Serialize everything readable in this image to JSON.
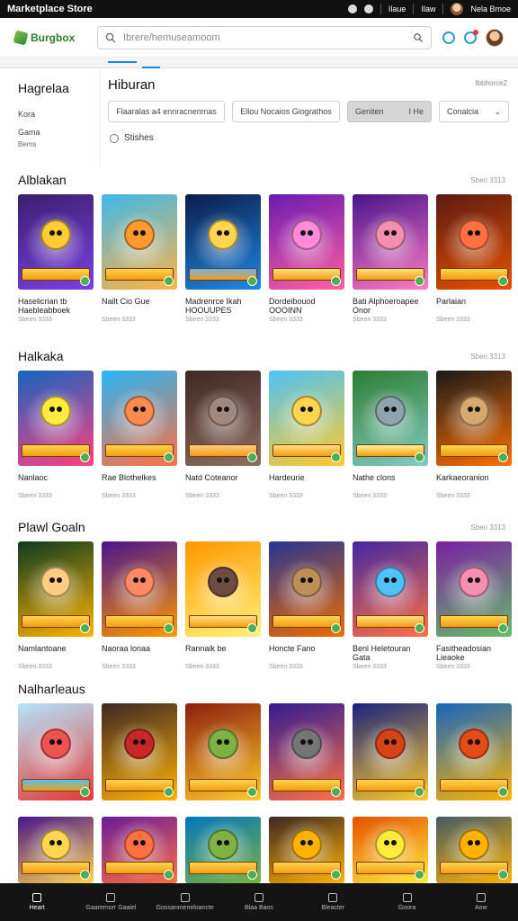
{
  "statusbar": {
    "title": "Marketplace Store",
    "item1": "Ilaue",
    "item2": "Ilaw",
    "user": "Nela Bmoe"
  },
  "header": {
    "logo": "Burgbox",
    "search_placeholder": "Ibrere/hemuseamoom"
  },
  "sidebar": {
    "title": "Hagrelaa",
    "items": [
      "Kora",
      "Gama"
    ],
    "sub": "Bems"
  },
  "main": {
    "title": "Hiburan",
    "topright": "Ibbhorce2",
    "filters": [
      "Flaaralas a4 ennracnenmas",
      "Ellou Nocaios Giograthos",
      "Geniten",
      "Conalcia"
    ],
    "filter_gray_extra": "I He",
    "checkbox_label": "Stishes"
  },
  "sections": [
    {
      "title": "Alblakan",
      "more": "Sberi 3313",
      "cards": [
        {
          "name": "Haselicrian tb Haebleabboek",
          "meta": "Sbeen 3333",
          "bg": "#3a1f6e",
          "accent": "#7b3fe4",
          "char": "#ffcc33",
          "title": "#ffd54f"
        },
        {
          "name": "Nailt Cio Gue",
          "meta": "Sbeen 3333",
          "bg": "#3fb8e8",
          "accent": "#ffb347",
          "char": "#ff9a2e",
          "title": "#ffd54f"
        },
        {
          "name": "Madrenrce Ikah HOOUUPES",
          "meta": "Sbeen 3333",
          "bg": "#0c1d4a",
          "accent": "#1e88e5",
          "char": "#ffd54f",
          "title": "#64b5f6"
        },
        {
          "name": "Dordeibouod OOOINN",
          "meta": "Sbeen 3333",
          "bg": "#6a1bb0",
          "accent": "#ff5fa2",
          "char": "#ff8ad6",
          "title": "#ffe082"
        },
        {
          "name": "Bati Alphoeroapee Onor",
          "meta": "Sbeen 3333",
          "bg": "#4a148c",
          "accent": "#ff7ac3",
          "char": "#f48fb1",
          "title": "#ffe082"
        },
        {
          "name": "Parlaian",
          "meta": "Sbeen 3333",
          "bg": "#5d1a12",
          "accent": "#e65100",
          "char": "#ff7043",
          "title": "#ffd54f"
        }
      ]
    },
    {
      "title": "Halkaka",
      "more": "Sberi 3313",
      "cards": [
        {
          "name": "Nanlaoc",
          "meta": "Sbeen 3333",
          "bg": "#1565c0",
          "accent": "#ff4081",
          "char": "#ffeb3b",
          "title": "#ffd54f"
        },
        {
          "name": "Rae Blothelkes",
          "meta": "Sbeen 3333",
          "bg": "#29b6f6",
          "accent": "#ff7043",
          "char": "#ff8a50",
          "title": "#ffd54f"
        },
        {
          "name": "Natd Coteanor",
          "meta": "Sbeen 3333",
          "bg": "#3e2723",
          "accent": "#8d6e63",
          "char": "#a1887f",
          "title": "#ffcc80"
        },
        {
          "name": "Hardeurie",
          "meta": "Sbeen 3333",
          "bg": "#4fc3f7",
          "accent": "#ffca28",
          "char": "#ffd54f",
          "title": "#ffe082"
        },
        {
          "name": "Nathe clons",
          "meta": "Sbeen 3333",
          "bg": "#2e7d32",
          "accent": "#80cbc4",
          "char": "#90a4ae",
          "title": "#fff59d"
        },
        {
          "name": "Karkaeoranion",
          "meta": "Sbeen 3333",
          "bg": "#1a1a1a",
          "accent": "#ff6f00",
          "char": "#d7a86e",
          "title": "#ffd54f"
        }
      ]
    },
    {
      "title": "Plawl Goaln",
      "more": "Sberi 3313",
      "cards": [
        {
          "name": "Namlantoane",
          "meta": "Sbeen 3333",
          "bg": "#0d3b20",
          "accent": "#ffb300",
          "char": "#ffcc80",
          "title": "#ffd54f"
        },
        {
          "name": "Naoraa lonaa",
          "meta": "Sbeen 3333",
          "bg": "#4a148c",
          "accent": "#ff9800",
          "char": "#ff8a65",
          "title": "#ffd54f"
        },
        {
          "name": "Rannaik be",
          "meta": "Sbeen 3333",
          "bg": "#ff9800",
          "accent": "#fff176",
          "char": "#6d4c41",
          "title": "#ffe082"
        },
        {
          "name": "Honcte Fano",
          "meta": "Sbeen 3333",
          "bg": "#283593",
          "accent": "#ef6c00",
          "char": "#bf8f5a",
          "title": "#ffd54f"
        },
        {
          "name": "Benl Heletouran Gata",
          "meta": "Sbeen 3333",
          "bg": "#4527a0",
          "accent": "#ff7043",
          "char": "#4fc3f7",
          "title": "#ffe082"
        },
        {
          "name": "Fasitheadosian Lieaoke",
          "meta": "Sbeen 3333",
          "bg": "#7b1fa2",
          "accent": "#66bb6a",
          "char": "#f48fb1",
          "title": "#ffd54f"
        }
      ]
    },
    {
      "title": "Nalharleaus",
      "more": "",
      "cards": [
        {
          "name": "",
          "meta": "",
          "bg": "#b3e5fc",
          "accent": "#e53935",
          "char": "#ef5350",
          "title": "#4fc3f7"
        },
        {
          "name": "",
          "meta": "",
          "bg": "#3e2723",
          "accent": "#ffb300",
          "char": "#c62828",
          "title": "#ffd54f"
        },
        {
          "name": "",
          "meta": "",
          "bg": "#8d1e0e",
          "accent": "#ffca28",
          "char": "#7cb342",
          "title": "#ffd54f"
        },
        {
          "name": "",
          "meta": "",
          "bg": "#311b92",
          "accent": "#ff7043",
          "char": "#757575",
          "title": "#ffd54f"
        },
        {
          "name": "",
          "meta": "",
          "bg": "#1a237e",
          "accent": "#ffca28",
          "char": "#d84315",
          "title": "#ffd54f"
        },
        {
          "name": "",
          "meta": "",
          "bg": "#1565c0",
          "accent": "#ffb300",
          "char": "#e64a19",
          "title": "#ffd54f"
        }
      ]
    }
  ],
  "bottom_row": [
    {
      "bg": "#4a148c",
      "accent": "#ffd54f"
    },
    {
      "bg": "#6a1b9a",
      "accent": "#ff7043"
    },
    {
      "bg": "#0277bd",
      "accent": "#7cb342"
    },
    {
      "bg": "#3e2723",
      "accent": "#ffb300"
    },
    {
      "bg": "#e65100",
      "accent": "#ffeb3b"
    },
    {
      "bg": "#455a64",
      "accent": "#ffb300"
    }
  ],
  "bottomnav": [
    {
      "label": "Heart",
      "active": true
    },
    {
      "label": "Gaaremorr Gaaiel",
      "active": false
    },
    {
      "label": "Gossanmeneloancte",
      "active": false
    },
    {
      "label": "Blaa Baos",
      "active": false
    },
    {
      "label": "Bleacter",
      "active": false
    },
    {
      "label": "Goora",
      "active": false
    },
    {
      "label": "Aow",
      "active": false
    }
  ],
  "colors": {
    "accent_blue": "#1e88e5",
    "brand_green": "#2e7d32",
    "statusbar_bg": "#111111",
    "nav_bg": "#141414"
  }
}
